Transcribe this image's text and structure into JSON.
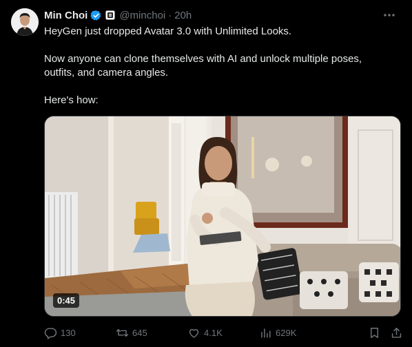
{
  "author": {
    "name": "Min Choi",
    "handle": "@minchoi",
    "separator": "·",
    "time": "20h",
    "verified_color": "#1d9bf0"
  },
  "tweet": {
    "paragraphs": [
      "HeyGen just dropped Avatar 3.0 with Unlimited Looks.",
      "Now anyone can clone themselves with AI and unlock multiple poses, outfits, and camera angles.",
      "Here's how:"
    ]
  },
  "media": {
    "type": "video",
    "duration": "0:45"
  },
  "actions": {
    "replies": "130",
    "reposts": "645",
    "likes": "4.1K",
    "views": "629K"
  },
  "icons": {
    "more": "more-icon",
    "reply": "reply-icon",
    "repost": "repost-icon",
    "like": "heart-icon",
    "views": "views-icon",
    "bookmark": "bookmark-icon",
    "share": "share-icon"
  }
}
